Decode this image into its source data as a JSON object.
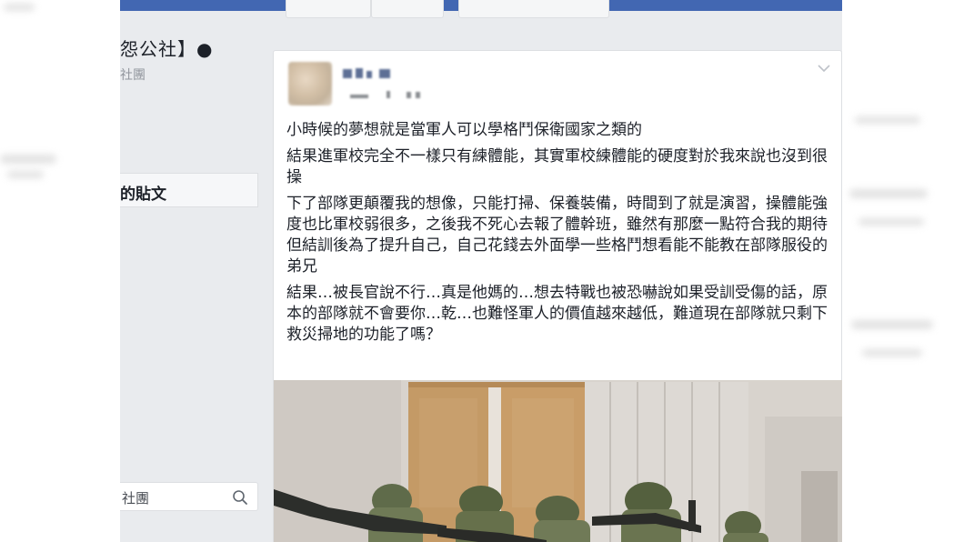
{
  "group": {
    "title": "怨公社】●",
    "subtitle": "社團",
    "nav_item": "的貼文",
    "search_placeholder": "社團"
  },
  "post": {
    "paragraphs": [
      "小時候的夢想就是當軍人可以學格鬥保衛國家之類的",
      "結果進軍校完全不一樣只有練體能，其實軍校練體能的硬度對於我來說也沒到很操",
      "下了部隊更顛覆我的想像，只能打掃、保養裝備，時間到了就是演習，操體能強度也比軍校弱很多，之後我不死心去報了體幹班，雖然有那麼一點符合我的期待但結訓後為了提升自己，自己花錢去外面學一些格鬥想看能不能教在部隊服役的弟兄",
      "結果…被長官說不行…真是他媽的…想去特戰也被恐嚇說如果受訓受傷的話，原本的部隊就不會要你…乾…也難怪軍人的價值越來越低，難道現在部隊就只剩下救災掃地的功能了嗎？"
    ]
  },
  "colors": {
    "topbar": "#4267b2",
    "page_bg": "#e9ebee",
    "card_bg": "#ffffff",
    "border": "#dddfe2"
  },
  "icons": {
    "search": "search-icon",
    "chevron": "chevron-down-icon"
  }
}
